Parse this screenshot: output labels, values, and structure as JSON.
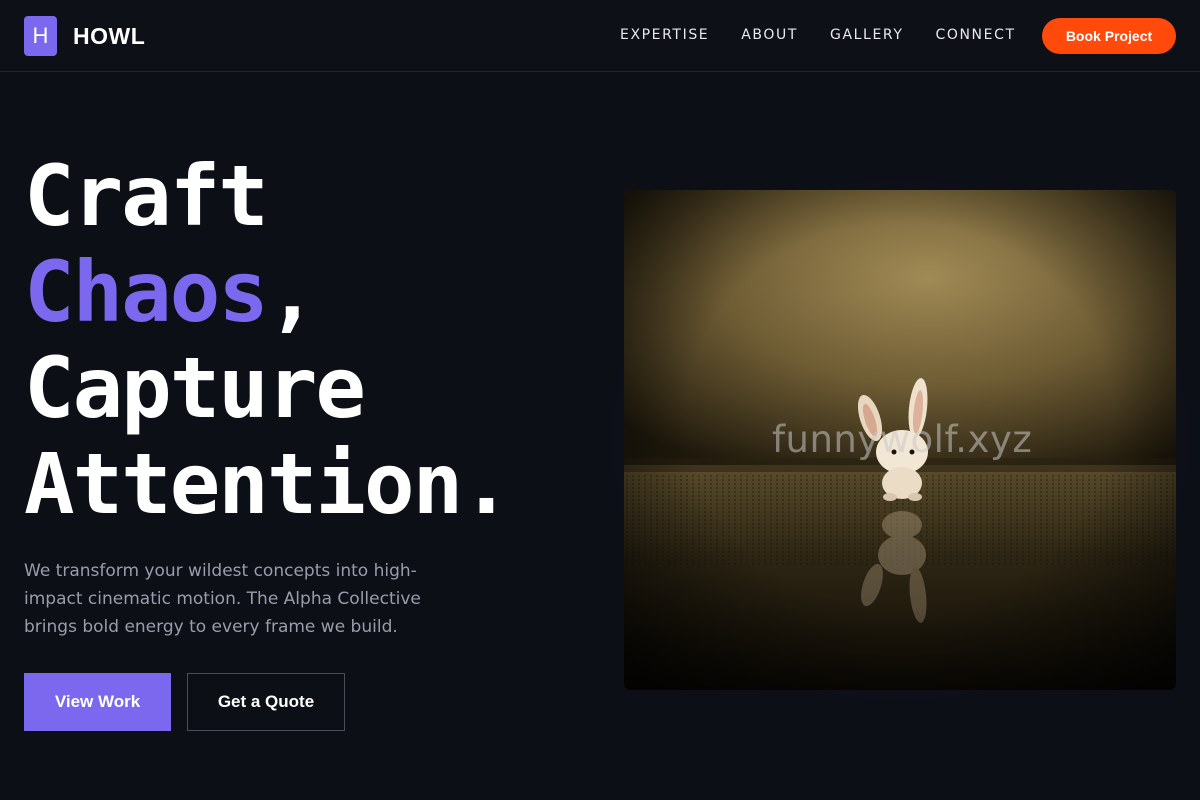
{
  "brand": {
    "logo_letter": "H",
    "name": "HOWL",
    "accent_color": "#7b68ee",
    "cta_color": "#ff4a0c"
  },
  "nav": {
    "links": [
      "EXPERTISE",
      "ABOUT",
      "GALLERY",
      "CONNECT"
    ],
    "cta_label": "Book Project"
  },
  "hero": {
    "headline_line1": "Craft",
    "headline_accent": "Chaos",
    "headline_comma": ",",
    "headline_line3": "Capture",
    "headline_line4": "Attention.",
    "subtext": "We transform your wildest concepts into high-impact cinematic motion. The Alpha Collective brings bold energy to every frame we build.",
    "primary_button": "View Work",
    "secondary_button": "Get a Quote"
  },
  "image": {
    "watermark": "funnywolf.xyz"
  }
}
